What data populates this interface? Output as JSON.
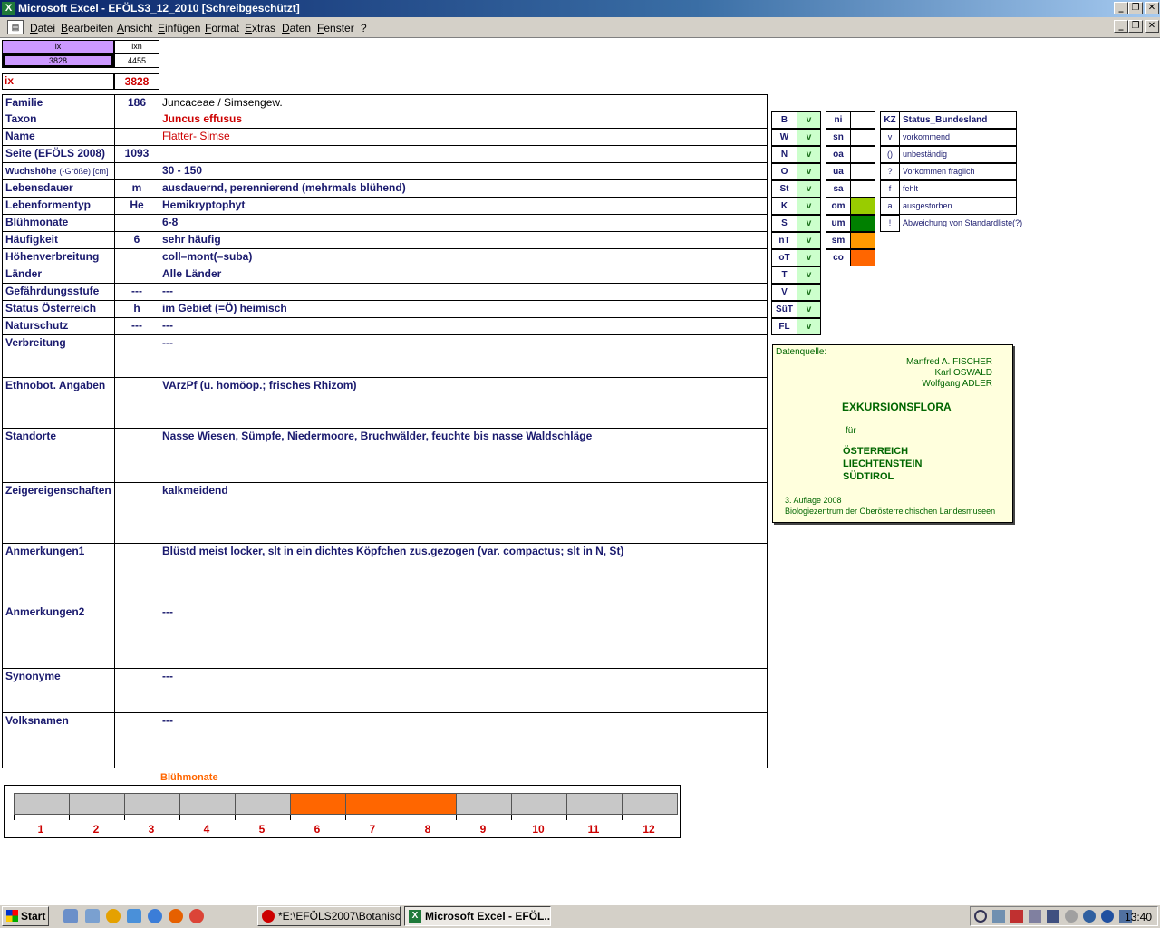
{
  "window": {
    "title": "Microsoft Excel - EFÖLS3_12_2010  [Schreibgeschützt]",
    "app_icon": "excel-icon"
  },
  "menu": [
    "Datei",
    "Bearbeiten",
    "Ansicht",
    "Einfügen",
    "Format",
    "Extras",
    "Daten",
    "Fenster",
    "?"
  ],
  "top": {
    "ix_header": "ix",
    "ixn_header": "ixn",
    "ix_value": "3828",
    "ixn_value": "4455",
    "ix_label": "ix",
    "ix_big": "3828"
  },
  "rows": [
    {
      "label": "Familie",
      "code": "186",
      "value": "Juncaceae  /  Simsengew."
    },
    {
      "label": "Taxon",
      "code": "",
      "value": "Juncus effusus"
    },
    {
      "label": "Name",
      "code": "",
      "value": "Flatter- Simse"
    },
    {
      "label": "Seite (EFÖLS 2008)",
      "code": "1093",
      "value": ""
    },
    {
      "label": "Wuchshöhe",
      "label_suffix": "(-Größe) [cm]",
      "code": "",
      "value": " 30 - 150"
    },
    {
      "label": "Lebensdauer",
      "code": "m",
      "value": "ausdauernd, perennierend (mehrmals blühend)"
    },
    {
      "label": "Lebenformentyp",
      "code": "He",
      "value": "Hemikryptophyt"
    },
    {
      "label": "Blühmonate",
      "code": "",
      "value": " 6-8"
    },
    {
      "label": "Häufigkeit",
      "code": "6",
      "value": "sehr häufig"
    },
    {
      "label": "Höhenverbreitung",
      "code": "",
      "value": "coll–mont(–suba)"
    },
    {
      "label": "Länder",
      "code": "",
      "value": "Alle Länder"
    },
    {
      "label": "Gefährdungsstufe",
      "code": "---",
      "value": " ---"
    },
    {
      "label": "Status Österreich",
      "code": "h",
      "value": "im Gebiet (=Ö) heimisch"
    },
    {
      "label": "Naturschutz",
      "code": "---",
      "value": " ---"
    },
    {
      "label": "Verbreitung",
      "code": "",
      "value": " ---"
    },
    {
      "label": "Ethnobot. Angaben",
      "code": "",
      "value": " VArzPf (u. homöop.; frisches Rhizom)"
    },
    {
      "label": "Standorte",
      "code": "",
      "value": "Nasse Wiesen, Sümpfe, Niedermoore, Bruchwälder, feuchte bis nasse Waldschläge"
    },
    {
      "label": "Zeigereigenschaften",
      "code": "",
      "value": "kalkmeidend"
    },
    {
      "label": "Anmerkungen1",
      "code": "",
      "value": "Blüstd meist locker, slt in ein dichtes Köpfchen zus.gezogen (var. compactus; slt in N, St)"
    },
    {
      "label": "Anmerkungen2",
      "code": "",
      "value": "---"
    },
    {
      "label": "Synonyme",
      "code": "",
      "value": "---"
    },
    {
      "label": "Volksnamen",
      "code": "",
      "value": "---"
    }
  ],
  "laender": [
    {
      "k": "B",
      "v": "v"
    },
    {
      "k": "W",
      "v": "v"
    },
    {
      "k": "N",
      "v": "v"
    },
    {
      "k": "O",
      "v": "v"
    },
    {
      "k": "St",
      "v": "v"
    },
    {
      "k": "K",
      "v": "v"
    },
    {
      "k": "S",
      "v": "v"
    },
    {
      "k": "nT",
      "v": "v"
    },
    {
      "k": "oT",
      "v": "v"
    },
    {
      "k": "T",
      "v": "v"
    },
    {
      "k": "V",
      "v": "v"
    },
    {
      "k": "SüT",
      "v": "v"
    },
    {
      "k": "FL",
      "v": "v"
    }
  ],
  "hoehen": [
    {
      "k": "ni",
      "color": ""
    },
    {
      "k": "sn",
      "color": ""
    },
    {
      "k": "oa",
      "color": ""
    },
    {
      "k": "ua",
      "color": ""
    },
    {
      "k": "sa",
      "color": ""
    },
    {
      "k": "om",
      "color": "#99cc00"
    },
    {
      "k": "um",
      "color": "#008000"
    },
    {
      "k": "sm",
      "color": "#ff9900"
    },
    {
      "k": "co",
      "color": "#ff6600"
    }
  ],
  "legend": {
    "kz_header": "KZ",
    "status_header": "Status_Bundesland",
    "items": [
      {
        "k": "v",
        "t": "vorkommend"
      },
      {
        "k": "()",
        "t": "unbeständig"
      },
      {
        "k": "?",
        "t": "Vorkommen fraglich"
      },
      {
        "k": "f",
        "t": "fehlt"
      },
      {
        "k": "a",
        "t": "ausgestorben"
      },
      {
        "k": "!",
        "t": "Abweichung von Standardliste(?)"
      }
    ]
  },
  "source": {
    "label": "Datenquelle:",
    "authors": [
      "Manfred A. FISCHER",
      "Karl OSWALD",
      "Wolfgang ADLER"
    ],
    "title": "EXKURSIONSFLORA",
    "fuer": "für",
    "countries": [
      "ÖSTERREICH",
      "LIECHTENSTEIN",
      "SÜDTIROL"
    ],
    "edition": "3. Auflage 2008",
    "publisher": "Biologiezentrum der Oberösterreichischen Landesmuseen"
  },
  "months": {
    "title": "Blühmonate",
    "labels": [
      "1",
      "2",
      "3",
      "4",
      "5",
      "6",
      "7",
      "8",
      "9",
      "10",
      "11",
      "12"
    ],
    "active": [
      6,
      7,
      8
    ],
    "active_color": "#ff6600",
    "inactive_color": "#c8c8c8"
  },
  "taskbar": {
    "start": "Start",
    "tasks": [
      "*E:\\EFÖLS2007\\Botanisc...",
      "Microsoft Excel - EFÖL..."
    ],
    "clock": "13:40"
  }
}
